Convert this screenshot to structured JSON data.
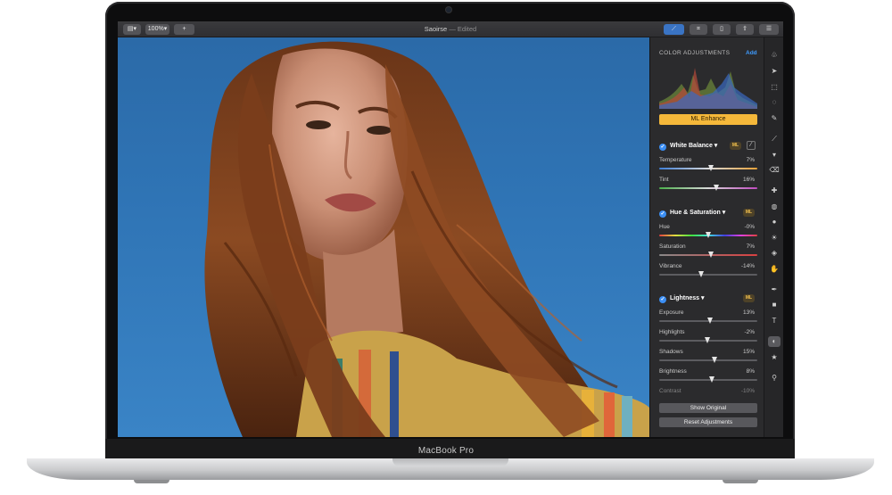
{
  "app": {
    "document_name": "Saoirse",
    "status": "— Edited",
    "zoom": "100%",
    "add_label": "+"
  },
  "device": {
    "brand": "MacBook Pro"
  },
  "panel": {
    "title": "COLOR ADJUSTMENTS",
    "add_label": "Add",
    "ml_enhance": "ML Enhance",
    "sections": [
      {
        "name": "White Balance",
        "badge": "ML",
        "sliders": [
          {
            "label": "Temperature",
            "value": "7%",
            "pos": 0.53
          },
          {
            "label": "Tint",
            "value": "16%",
            "pos": 0.58
          }
        ]
      },
      {
        "name": "Hue & Saturation",
        "badge": "ML",
        "sliders": [
          {
            "label": "Hue",
            "value": "-0%",
            "pos": 0.5
          },
          {
            "label": "Saturation",
            "value": "7%",
            "pos": 0.53
          },
          {
            "label": "Vibrance",
            "value": "-14%",
            "pos": 0.43
          }
        ]
      },
      {
        "name": "Lightness",
        "badge": "ML",
        "sliders": [
          {
            "label": "Exposure",
            "value": "13%",
            "pos": 0.52
          },
          {
            "label": "Highlights",
            "value": "-2%",
            "pos": 0.49
          },
          {
            "label": "Shadows",
            "value": "15%",
            "pos": 0.56
          },
          {
            "label": "Brightness",
            "value": "8%",
            "pos": 0.54
          },
          {
            "label": "Contrast",
            "value": "-10%",
            "pos": 0.45
          }
        ]
      }
    ],
    "show_original": "Show Original",
    "reset_adjustments": "Reset Adjustments"
  },
  "tools": [
    "arrange-icon",
    "pointer-icon",
    "selection-icon",
    "lasso-icon",
    "paint-select-icon",
    "brush-icon",
    "fill-icon",
    "eraser-icon",
    "repair-icon",
    "clone-icon",
    "blur-icon",
    "light-icon",
    "sharpen-icon",
    "smudge-icon",
    "pen-icon",
    "shape-icon",
    "text-icon",
    "color-adjust-icon",
    "effects-icon",
    "zoom-icon"
  ],
  "colors": {
    "accent": "#3b8ef3",
    "ml_yellow": "#f5b83a"
  }
}
